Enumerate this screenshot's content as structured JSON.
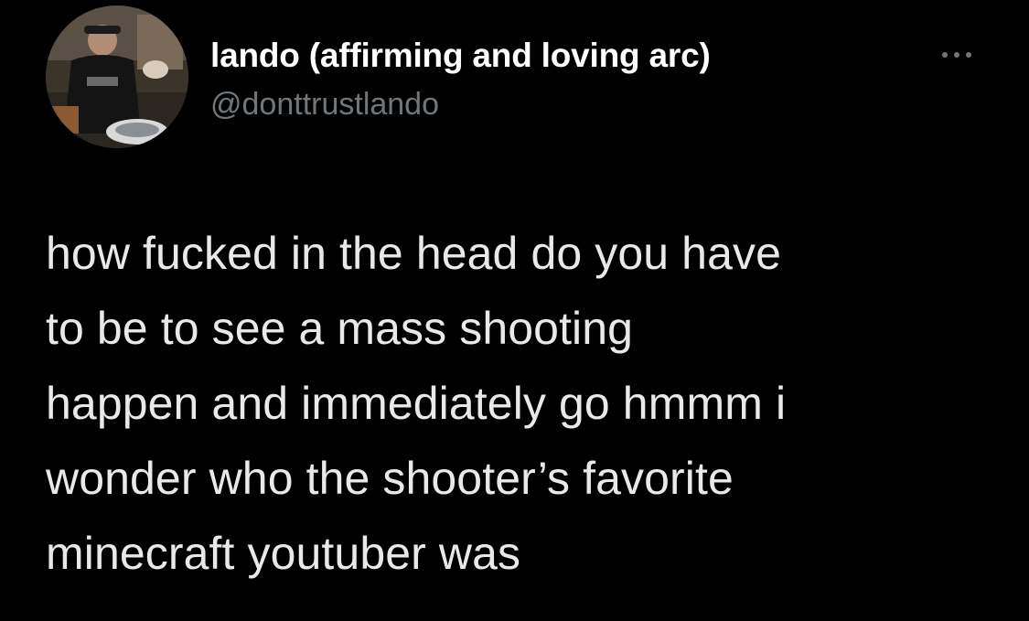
{
  "tweet": {
    "author": {
      "display_name": "lando (affirming and loving arc)",
      "handle": "@donttrustlando",
      "avatar_icon": "profile-photo"
    },
    "more_icon": "ellipsis-horizontal-icon",
    "text": "how fucked in the head do you have\nto be to see a mass shooting\nhappen and immediately go hmmm i\nwonder who the shooter’s favorite\nminecraft youtuber was"
  },
  "colors": {
    "background": "#000000",
    "primary_text": "#e7e9ea",
    "display_name": "#ffffff",
    "secondary_text": "#71767b"
  }
}
